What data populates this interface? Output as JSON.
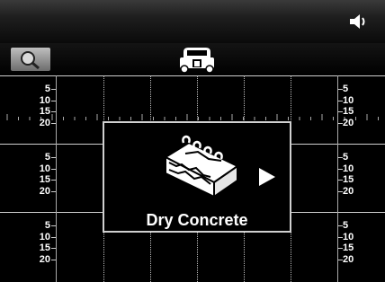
{
  "status": {
    "icon": "speaker-volume-icon"
  },
  "toolbar": {
    "zoom_icon": "magnifier-icon",
    "scanner_icon": "scanner-cart-icon"
  },
  "scan_grid": {
    "depth_rows": [
      [
        "5",
        "10",
        "15",
        "20"
      ],
      [
        "5",
        "10",
        "15",
        "20"
      ],
      [
        "5",
        "10",
        "15",
        "20"
      ]
    ]
  },
  "mode_popup": {
    "label": "Dry Concrete",
    "icon": "concrete-block-icon",
    "next_icon": "play-arrow-icon"
  }
}
